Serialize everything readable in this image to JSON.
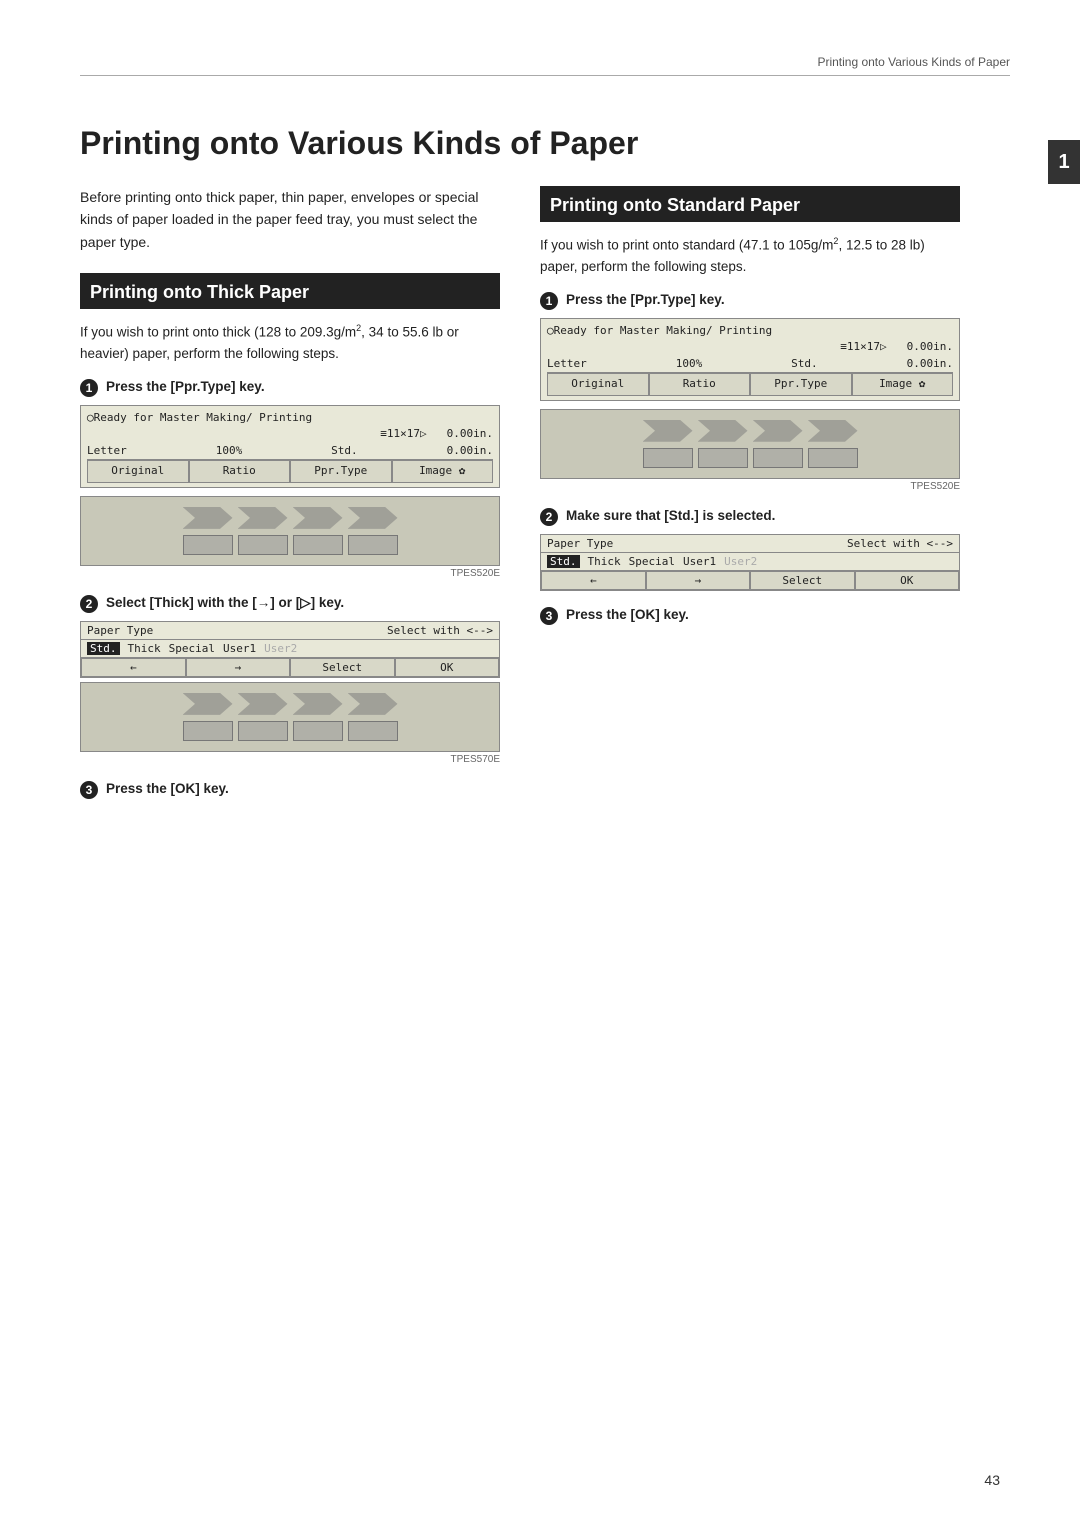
{
  "header": {
    "text": "Printing onto Various Kinds of Paper"
  },
  "page": {
    "title": "Printing onto Various Kinds of Paper",
    "number": "43"
  },
  "tab_number": "1",
  "intro": {
    "text": "Before printing onto thick paper, thin paper, envelopes or special kinds of paper loaded in the paper feed tray, you must select the paper type."
  },
  "left_section": {
    "heading": "Printing onto Thick Paper",
    "body": "If you wish to print onto thick (128 to 209.3g/m², 34 to 55.6 lb or heavier) paper, perform the following steps.",
    "step1": {
      "label": "Press the [Ppr.Type] key.",
      "lcd": {
        "line1": "◯Ready for Master Making/ Printing",
        "line2_label": "≡11×17▷",
        "line2_val": "0.00in.",
        "line3_label1": "Letter",
        "line3_label2": "100%",
        "line3_label3": "Std.",
        "line3_val": "0.00in.",
        "btns": [
          "Original",
          "Ratio",
          "Ppr.Type",
          "Image ✿"
        ]
      },
      "caption": "TPES520E"
    },
    "step2": {
      "label": "Select [Thick] with the [→] or [▷] key.",
      "pt_header": "Paper Type",
      "pt_select": "Select with ←→",
      "pt_options": [
        "Std.",
        "Thick",
        "Special",
        "User1",
        "User2"
      ],
      "pt_selected_index": 0,
      "pt_btns": [
        "←",
        "→",
        "Select",
        "OK"
      ],
      "caption": "TPES570E"
    },
    "step3": {
      "label": "Press the [OK] key."
    }
  },
  "right_section": {
    "heading": "Printing onto Standard Paper",
    "body": "If you wish to print onto standard (47.1 to 105g/m², 12.5 to 28 lb) paper, perform the following steps.",
    "step1": {
      "label": "Press the [Ppr.Type] key.",
      "lcd": {
        "line1": "◯Ready for Master Making/ Printing",
        "line2_label": "≡11×17▷",
        "line2_val": "0.00in.",
        "line3_label1": "Letter",
        "line3_label2": "100%",
        "line3_label3": "Std.",
        "line3_val": "0.00in.",
        "btns": [
          "Original",
          "Ratio",
          "Ppr.Type",
          "Image ✿"
        ]
      },
      "caption": "TPES520E"
    },
    "step2": {
      "label": "Make sure that [Std.] is selected.",
      "pt_header": "Paper Type",
      "pt_select": "Select with ←→",
      "pt_options": [
        "Std.",
        "Thick",
        "Special",
        "User1",
        "User2"
      ],
      "pt_selected_index": 0,
      "pt_btns": [
        "←",
        "→",
        "Select",
        "OK"
      ]
    },
    "step3": {
      "label": "Press the [OK] key."
    }
  }
}
